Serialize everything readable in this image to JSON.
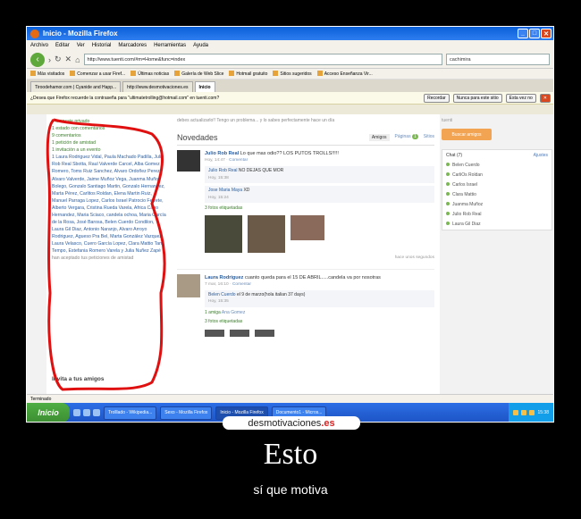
{
  "window": {
    "title": "Inicio - Mozilla Firefox",
    "status": "Terminado"
  },
  "menu": [
    "Archivo",
    "Editar",
    "Ver",
    "Historial",
    "Marcadores",
    "Herramientas",
    "Ayuda"
  ],
  "nav": {
    "url": "http://www.tuenti.com/#m=Home&func=index",
    "search": "cachimira"
  },
  "bookmarks": [
    "Más visitados",
    "Comenzar a usar Firef...",
    "Últimas noticias",
    "Galería de Web Slice",
    "Hotmail gratuito",
    "Sitios sugeridos",
    "Acceso Enseñanza Vir..."
  ],
  "tabs": [
    "Tiroodehamor.com | Cyanide and Happ...",
    "http://www.desmotivaciones.es",
    "Inicio"
  ],
  "notif": {
    "text": "¿Desea que Firefox recuerde la contraseña para \"ultimatetrolling@hotmail.com\" en tuenti.com?",
    "remember": "Recordar",
    "never": "Nunca para este sitio",
    "notnow": "Esta vez no"
  },
  "left": {
    "items": [
      {
        "text": "1 mensaje privado",
        "color": "g"
      },
      {
        "text": "1 estado con comentarios",
        "color": "g"
      },
      {
        "text": "9 comentarios",
        "color": "g"
      },
      {
        "text": "1 petición de amistad",
        "color": "g"
      },
      {
        "text": "1 invitación a un evento",
        "color": "g"
      }
    ],
    "friends": "1 Laura Rodriguez Vidal, Paula Machado Padilla, Julio Rob Real Sbotta, Raul Valverde Carcel, Alba Gomez Romero, Toms Ruiz Sanchez, Alvaro Ordoñez Perez, Alvaro Valverde, Jaime Muñoz Vega, Juanma Muñoz Bolego, Gonzalo Santiago Martin, Gonzalo Hernandez, Marta Pérez, Carlitos Roldan, Elena Martin Ruiz, Manuel Parraga Lopez, Carlos Israel Patrocio Ferrete, Alberto Vergara, Cristina Rueda Varela, Africa Cabo Hernandez, Maria Sciaco, candela ochoa, Maria García de la Rosa, José Barosa, Belen Cuerdo Condilon, Laura Gil Diaz, Antonio Naranjo, Alvaro Arroyo Rodriguez, Agueso Pra Bel, Marta González Vazquez, Laura Velasco, Cuero García Lopez, Clara Mattio Tan Tempo, Estefania Romero Varela y Julia Nuñez Zapé",
    "friends_tail": "han aceptado tus peticiones de amistad",
    "invite": "Invita a tus amigos"
  },
  "main": {
    "top_text": "debes actualizarlo!! Tengo un problema... y lo sabes perfectamente hace un día",
    "novedades": "Novedades",
    "filter_tabs": [
      "Amigos",
      "Páginas",
      "Sitios"
    ],
    "paginas_badge": "1",
    "post1": {
      "name": "Julio Rob Real",
      "text": "Lo que mas odio?? LOS PUTOS TROLLS!!!!!",
      "time": "Hoy, 14:47",
      "action": "Comentar",
      "comments": [
        {
          "name": "Julio Rob Real",
          "text": "NO DEJAS QUE MOR",
          "time": "Hoy, 15:38"
        },
        {
          "name": "Jose Maria Maya",
          "text": "XD",
          "time": "Hoy, 15:24"
        }
      ],
      "tagged": "3 fotos etiquetadas",
      "more": "hace unos segundos"
    },
    "post2": {
      "name": "Laura Rodriguez",
      "text": "cuanto queda para el 15 DE ABRIL.....candela va por nosotras",
      "time": "7 mar, 16:10",
      "action": "Comentar",
      "comment_name": "Belen Cuerdo",
      "comment_text": "el 9 de marzo(hola italian 37 days)",
      "comment_time": "Hoy, 15:35",
      "friend_line": "1 amiga",
      "friend_name": "Ana Gomez",
      "tagged": "3 fotos etiquetadas"
    }
  },
  "right": {
    "top": "tuenti",
    "button": "Buscar amigos",
    "chat_title": "Chat (7)",
    "chat_settings": "Ajustes",
    "friends": [
      "Belen Cuerdo",
      "CarliOs Roldan",
      "Carlos Israel",
      "Clara Mattio",
      "Juanma Muñoz",
      "Julio Rob Real",
      "Laura Gil Diaz"
    ]
  },
  "taskbar": {
    "start": "Inicio",
    "items": [
      "Trolllado - Wikipedia...",
      "Sexo - Mozilla Firefox",
      "Inicio - Mozilla Firefox",
      "Documento1 - Micros..."
    ],
    "clock": "15:38"
  },
  "brand": {
    "pre": "desmotivaciones",
    "post": ".es"
  },
  "headline": "Esto",
  "caption": "sí que motiva"
}
